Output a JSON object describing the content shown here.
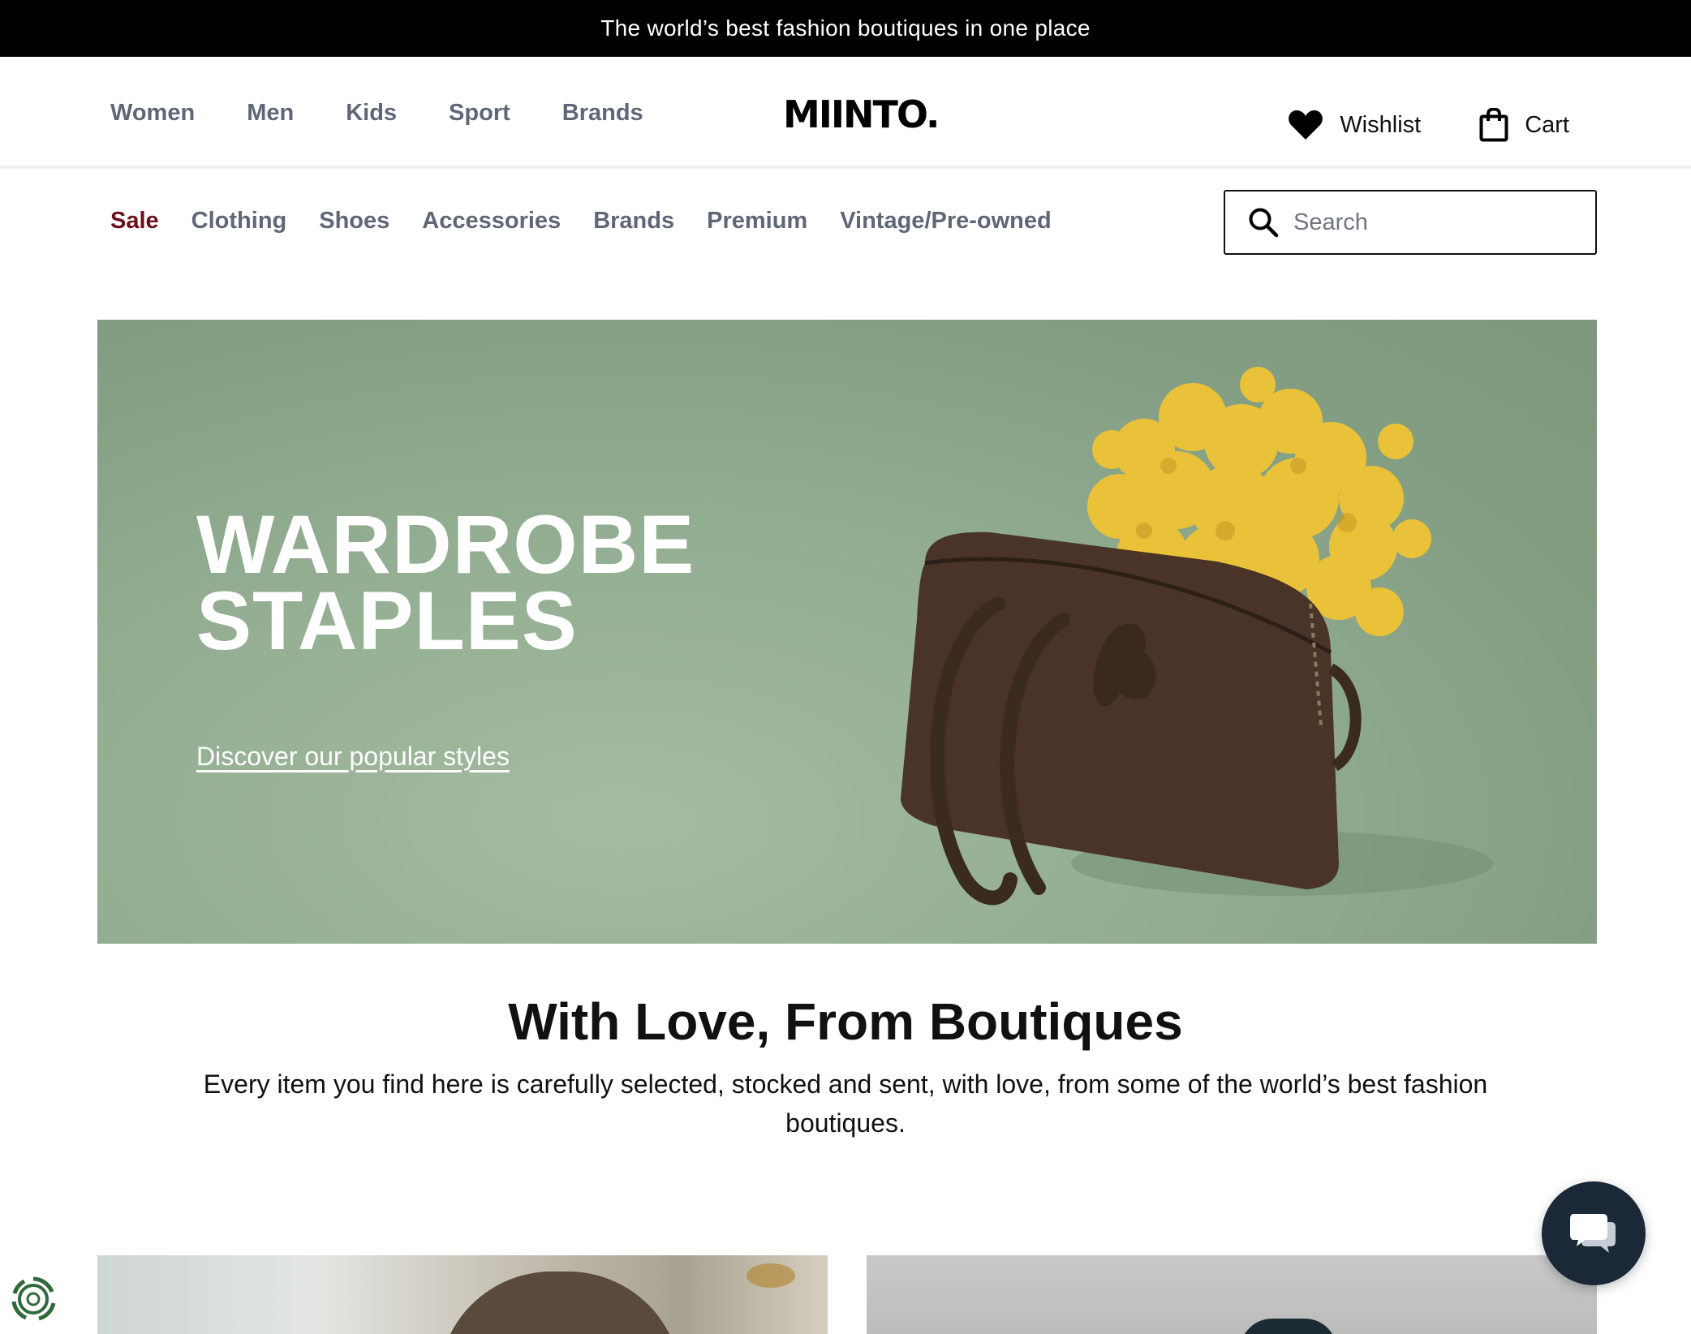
{
  "announcement": {
    "text": "The world’s best fashion boutiques in one place"
  },
  "header": {
    "logo": "MIINTO.",
    "main_nav": [
      "Women",
      "Men",
      "Kids",
      "Sport",
      "Brands"
    ],
    "wishlist_label": "Wishlist",
    "cart_label": "Cart"
  },
  "sub_nav": {
    "items": [
      "Sale",
      "Clothing",
      "Shoes",
      "Accessories",
      "Brands",
      "Premium",
      "Vintage/Pre-owned"
    ]
  },
  "search": {
    "placeholder": "Search"
  },
  "hero": {
    "title_line1": "WARDROBE",
    "title_line2": "STAPLES",
    "link_text": "Discover our popular styles"
  },
  "intro": {
    "title": "With Love, From Boutiques",
    "description": "Every item you find here is carefully selected, stocked and sent, with love, from some of the world’s best fashion boutiques."
  },
  "colors": {
    "sale": "#6b0f1a",
    "nav_text": "#5f6675",
    "hero_bg": "#93ae92",
    "chat_button": "#1b2838"
  },
  "icons": [
    "heart-icon",
    "shopping-bag-icon",
    "search-icon",
    "chat-icon",
    "cookie-settings-icon"
  ]
}
